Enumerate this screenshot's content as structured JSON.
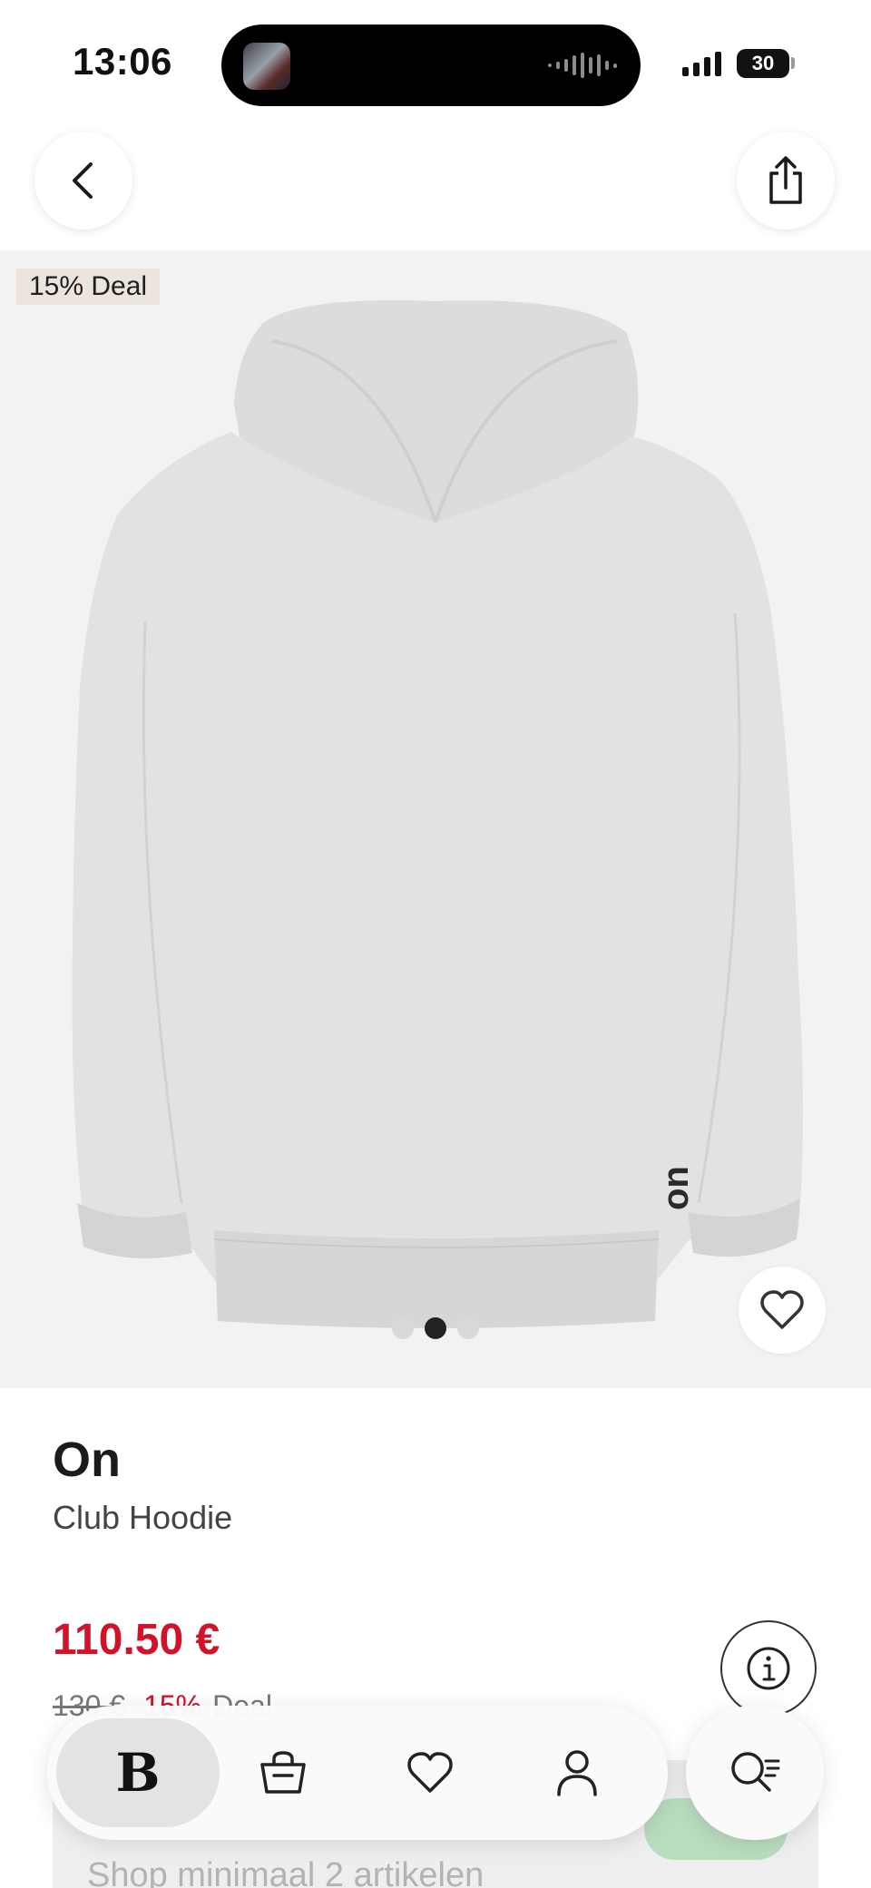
{
  "status_bar": {
    "time": "13:06",
    "battery": "30"
  },
  "product": {
    "badge": "15% Deal",
    "brand": "On",
    "name": "Club Hoodie",
    "price": "110.50 €",
    "original_price": "130 €",
    "discount_percent": "15%",
    "discount_label": "Deal",
    "image_count": 3,
    "active_image": 2
  },
  "promo": {
    "text": "Shop minimaal 2 artikelen"
  },
  "tab_bar": {
    "home_logo": "B",
    "items": [
      {
        "name": "home",
        "icon": "brand-b-icon"
      },
      {
        "name": "bag",
        "icon": "shopping-bag-icon"
      },
      {
        "name": "wishlist",
        "icon": "heart-icon"
      },
      {
        "name": "profile",
        "icon": "person-icon"
      }
    ],
    "search_icon": "search-list-icon"
  },
  "colors": {
    "price_red": "#d3122a",
    "badge_bg": "#ece5dd",
    "image_bg": "#f2f2f2"
  }
}
